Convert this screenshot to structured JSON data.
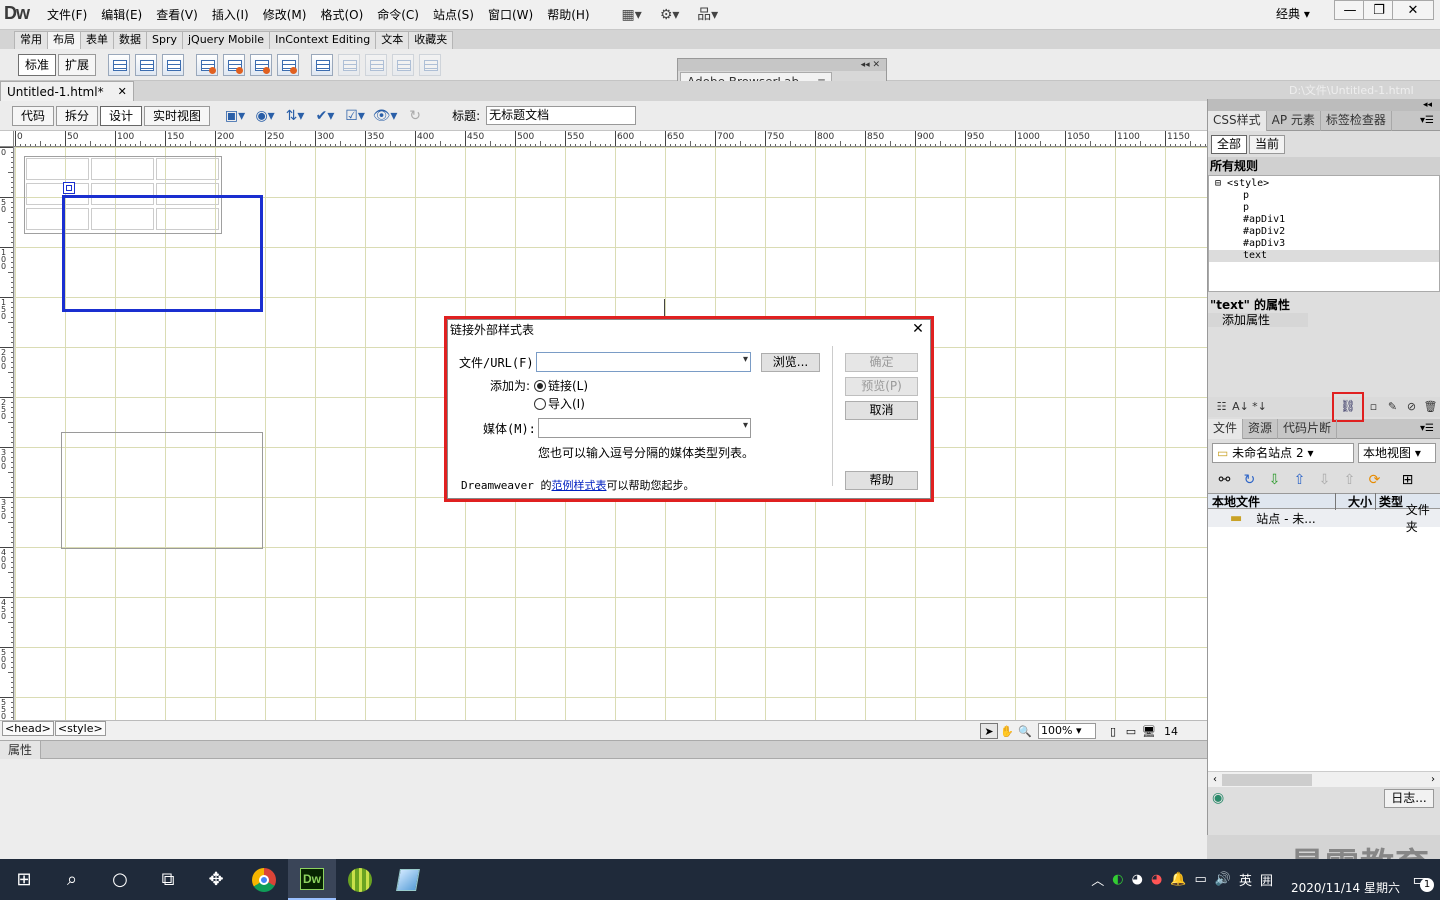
{
  "app": {
    "logo": "Dw",
    "menus": [
      "文件(F)",
      "编辑(E)",
      "查看(V)",
      "插入(I)",
      "修改(M)",
      "格式(O)",
      "命令(C)",
      "站点(S)",
      "窗口(W)",
      "帮助(H)"
    ],
    "workspace": "经典",
    "window_buttons": {
      "minimize": "—",
      "restore": "❐",
      "close": "✕"
    }
  },
  "insert_bar": {
    "tabs": [
      "常用",
      "布局",
      "表单",
      "数据",
      "Spry",
      "jQuery Mobile",
      "InContext Editing",
      "文本",
      "收藏夹"
    ],
    "active_tab": "布局",
    "mode_buttons": [
      "标准",
      "扩展"
    ]
  },
  "browserlab": {
    "label": "Adobe BrowserLab"
  },
  "document": {
    "tab_label": "Untitled-1.html*",
    "tab_close": "✕",
    "path": "D:\\文件\\Untitled-1.html",
    "view_buttons": [
      "代码",
      "拆分",
      "设计",
      "实时视图"
    ],
    "active_view": "设计",
    "title_label": "标题:",
    "title_value": "无标题文档"
  },
  "ruler": {
    "h_ticks": [
      "0",
      "50",
      "100",
      "150",
      "200",
      "250",
      "300",
      "350",
      "400",
      "450",
      "500",
      "550",
      "600",
      "650",
      "700",
      "750",
      "800",
      "850",
      "900",
      "950",
      "1000",
      "1050",
      "1100",
      "1150"
    ],
    "v_ticks": [
      "0",
      "50",
      "100",
      "150",
      "200",
      "250",
      "300",
      "350",
      "400",
      "450",
      "500",
      "550"
    ]
  },
  "status_bar": {
    "tags": [
      "<head>",
      "<style>"
    ],
    "zoom": "100%",
    "size_text": "14"
  },
  "properties": {
    "tab_label": "属性"
  },
  "css_panel": {
    "tabs": [
      "CSS样式",
      "AP 元素",
      "标签检查器"
    ],
    "mode_buttons": [
      "全部",
      "当前"
    ],
    "active_mode": "全部",
    "rules_header": "所有规则",
    "rules_root": "<style>",
    "rules": [
      "p",
      "p",
      "#apDiv1",
      "#apDiv2",
      "#apDiv3",
      "text"
    ],
    "selected_rule": "text",
    "props_title": "\"text\" 的属性",
    "add_property": "添加属性"
  },
  "files_panel": {
    "tabs": [
      "文件",
      "资源",
      "代码片断"
    ],
    "site": "未命名站点 2",
    "view": "本地视图",
    "columns": [
      "本地文件",
      "大小",
      "类型"
    ],
    "rows": [
      {
        "name": "站点 - 未...",
        "size": "",
        "type": "文件夹"
      }
    ],
    "log_button": "日志..."
  },
  "dialog": {
    "title": "链接外部样式表",
    "file_label": "文件/URL(F):",
    "file_value": "",
    "browse": "浏览...",
    "add_as_label": "添加为:",
    "option_link": "链接(L)",
    "option_import": "导入(I)",
    "selected_option": "link",
    "media_label": "媒体(M):",
    "media_value": "",
    "media_hint": "您也可以输入逗号分隔的媒体类型列表。",
    "footer_prefix": "Dreamweaver 的",
    "footer_link": "范例样式表",
    "footer_suffix": "可以帮助您起步。",
    "ok": "确定",
    "preview": "预览(P)",
    "cancel": "取消",
    "help": "帮助",
    "close": "✕"
  },
  "taskbar": {
    "ime": "英",
    "ime2": "囲",
    "date": "2020/11/14 星期六",
    "notification_count": "1"
  },
  "watermark": "最需教育"
}
